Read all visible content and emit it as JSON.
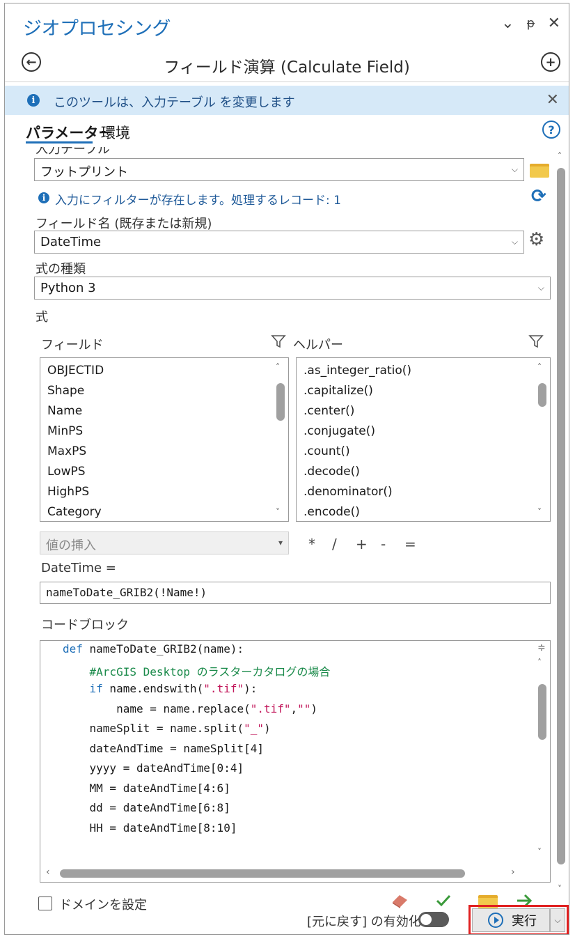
{
  "header": {
    "pane_title": "ジオプロセシング",
    "tool_title": "フィールド演算 (Calculate Field)"
  },
  "info_bar": {
    "message": "このツールは、入力テーブル を変更します"
  },
  "tabs": [
    {
      "label": "パラメーター",
      "active": true
    },
    {
      "label": "環境",
      "active": false
    }
  ],
  "params": {
    "input_table_label": "入力テーブル",
    "input_table_value": "フットプリント",
    "filter_message": "入力にフィルターが存在します。処理するレコード: 1",
    "field_name_label": "フィールド名 (既存または新規)",
    "field_name_value": "DateTime",
    "expression_type_label": "式の種類",
    "expression_type_value": "Python 3",
    "expression_label": "式"
  },
  "fields": {
    "header": "フィールド",
    "items": [
      "OBJECTID",
      "Shape",
      "Name",
      "MinPS",
      "MaxPS",
      "LowPS",
      "HighPS",
      "Category"
    ]
  },
  "helpers": {
    "header": "ヘルパー",
    "items": [
      ".as_integer_ratio()",
      ".capitalize()",
      ".center()",
      ".conjugate()",
      ".count()",
      ".decode()",
      ".denominator()",
      ".encode()"
    ]
  },
  "insert_value": {
    "placeholder": "値の挿入"
  },
  "operators": [
    "*",
    "/",
    "+",
    "-",
    "="
  ],
  "expression": {
    "label": "DateTime =",
    "value": "nameToDate_GRIB2(!Name!)"
  },
  "code_block": {
    "label": "コードブロック",
    "lines": [
      [
        {
          "t": "def ",
          "c": "kw"
        },
        {
          "t": "nameToDate_GRIB2(name):",
          "c": ""
        }
      ],
      [
        {
          "t": "    #ArcGIS Desktop のラスターカタログの場合",
          "c": "cm"
        }
      ],
      [
        {
          "t": "    ",
          "c": ""
        },
        {
          "t": "if",
          "c": "kw"
        },
        {
          "t": " name.endswith(",
          "c": ""
        },
        {
          "t": "\".tif\"",
          "c": "st"
        },
        {
          "t": "):",
          "c": ""
        }
      ],
      [
        {
          "t": "        name = name.replace(",
          "c": ""
        },
        {
          "t": "\".tif\"",
          "c": "st"
        },
        {
          "t": ",",
          "c": ""
        },
        {
          "t": "\"\"",
          "c": "st"
        },
        {
          "t": ")",
          "c": ""
        }
      ],
      [
        {
          "t": "    nameSplit = name.split(",
          "c": ""
        },
        {
          "t": "\"_\"",
          "c": "st"
        },
        {
          "t": ")",
          "c": ""
        }
      ],
      [
        {
          "t": "    dateAndTime = nameSplit[4]",
          "c": ""
        }
      ],
      [
        {
          "t": "    yyyy = dateAndTime[0:4]",
          "c": ""
        }
      ],
      [
        {
          "t": "    MM = dateAndTime[4:6]",
          "c": ""
        }
      ],
      [
        {
          "t": "    dd = dateAndTime[6:8]",
          "c": ""
        }
      ],
      [
        {
          "t": "    HH = dateAndTime[8:10]",
          "c": ""
        }
      ]
    ]
  },
  "footer": {
    "set_domain_label": "ドメインを設定",
    "enable_undo_label": "[元に戻す] の有効化",
    "run_label": "実行"
  },
  "colors": {
    "accent": "#1e6fb8",
    "info_bg": "#d6e9f8",
    "highlight_border": "#e02020"
  }
}
